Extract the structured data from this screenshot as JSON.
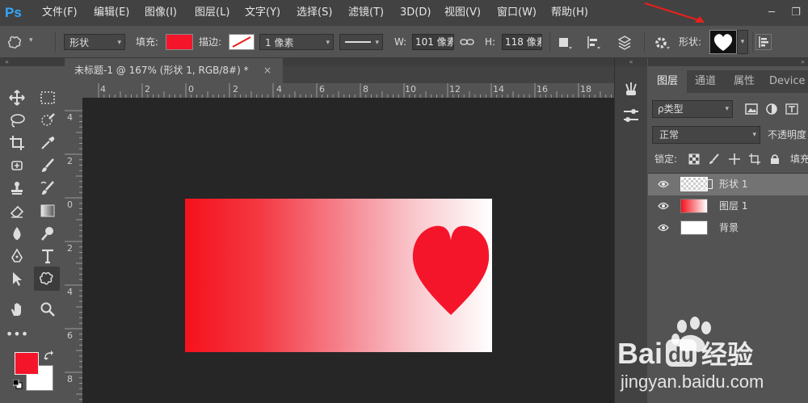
{
  "app": {
    "logo": "Ps"
  },
  "menu": [
    "文件(F)",
    "编辑(E)",
    "图像(I)",
    "图层(L)",
    "文字(Y)",
    "选择(S)",
    "滤镜(T)",
    "3D(D)",
    "视图(V)",
    "窗口(W)",
    "帮助(H)"
  ],
  "window_controls": {
    "minimize": "─",
    "restore": "❐"
  },
  "options": {
    "tool_icon": "custom-shape-tool-icon",
    "mode": "形状",
    "fill_label": "填充:",
    "fill_color": "#f5152a",
    "stroke_label": "描边:",
    "stroke_width": "1 像素",
    "w_label": "W:",
    "w_value": "101 像素",
    "h_label": "H:",
    "h_value": "118 像素",
    "shape_label": "形状:"
  },
  "document_tab": {
    "title": "未标题-1 @ 167% (形状 1, RGB/8#) *",
    "close": "×"
  },
  "ruler_h": [
    "4",
    "2",
    "0",
    "2",
    "4",
    "6",
    "8",
    "10",
    "12",
    "14",
    "16",
    "18"
  ],
  "ruler_v": [
    "4",
    "2",
    "0",
    "2",
    "4",
    "6",
    "8"
  ],
  "tool_colors": {
    "foreground": "#f5152a",
    "background": "#ffffff"
  },
  "layers_panel": {
    "tabs": [
      "图层",
      "通道",
      "属性",
      "Device P"
    ],
    "filter_kind": "ρ类型",
    "blend_mode": "正常",
    "opacity_label": "不透明度",
    "lock_label": "锁定:",
    "fill_label": "填充",
    "layers": [
      {
        "name": "形状 1",
        "selected": true
      },
      {
        "name": "图层 1",
        "selected": false
      },
      {
        "name": "背景",
        "selected": false
      }
    ]
  },
  "heart_color": "#f5152a",
  "watermark": {
    "brand": "Bai经验",
    "url": "jingyan.baidu.com"
  }
}
